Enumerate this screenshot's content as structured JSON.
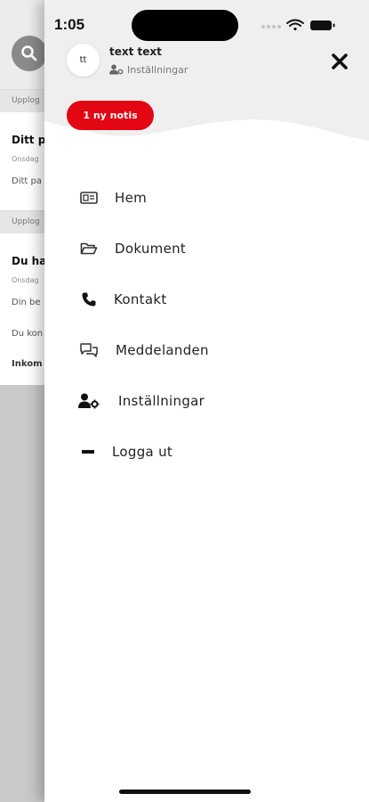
{
  "background": {
    "sections": [
      {
        "label": "Upplog"
      },
      {
        "label": "Upplog"
      }
    ],
    "item1": {
      "title": "Ditt p",
      "date": "Onsdag",
      "body": "Ditt pa"
    },
    "item2": {
      "title": "Du ha",
      "date": "Onsdag",
      "body1": "Din be",
      "body2": "Du kon",
      "body3": "Inkom"
    }
  },
  "status_bar": {
    "time": "1:05"
  },
  "drawer": {
    "avatar_initials": "tt",
    "user_name": "text text",
    "settings_link": "Inställningar",
    "notice_badge": "1 ny notis",
    "menu": [
      {
        "label": "Hem",
        "icon": "home-card-icon"
      },
      {
        "label": "Dokument",
        "icon": "folder-icon"
      },
      {
        "label": "Kontakt",
        "icon": "phone-icon"
      },
      {
        "label": "Meddelanden",
        "icon": "chat-bubbles-icon"
      },
      {
        "label": "Inställningar",
        "icon": "user-settings-icon"
      },
      {
        "label": "Logga ut",
        "icon": "logout-minus-icon"
      }
    ]
  },
  "colors": {
    "accent": "#e30613",
    "drawer_header": "#efefef",
    "overlay": "#c9c9c9"
  }
}
